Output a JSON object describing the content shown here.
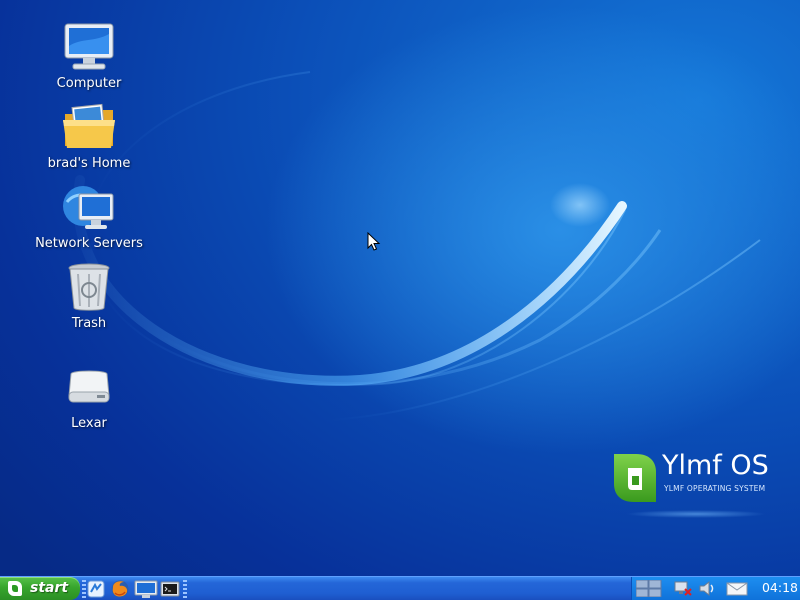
{
  "desktop": {
    "icons": [
      {
        "label": "Computer",
        "icon": "computer-icon"
      },
      {
        "label": "brad's Home",
        "icon": "home-folder-icon"
      },
      {
        "label": "Network Servers",
        "icon": "network-servers-icon"
      },
      {
        "label": "Trash",
        "icon": "trash-icon"
      },
      {
        "label": "Lexar",
        "icon": "drive-icon"
      }
    ],
    "logo": {
      "brand": "Ylmf OS",
      "subtitle": "YLMF OPERATING SYSTEM",
      "accent": "#5ab82c"
    },
    "background_colors": [
      "#1477d8",
      "#0b4fb8",
      "#062a86"
    ]
  },
  "taskbar": {
    "start_label": "start",
    "start_color": "#37a52d",
    "quick_launch": [
      "file-manager-icon",
      "firefox-icon",
      "show-desktop-icon",
      "terminal-icon"
    ],
    "tray": [
      "workspace-switcher-icon",
      "network-disconnected-icon",
      "volume-icon",
      "mail-icon"
    ],
    "clock": "04:18"
  }
}
